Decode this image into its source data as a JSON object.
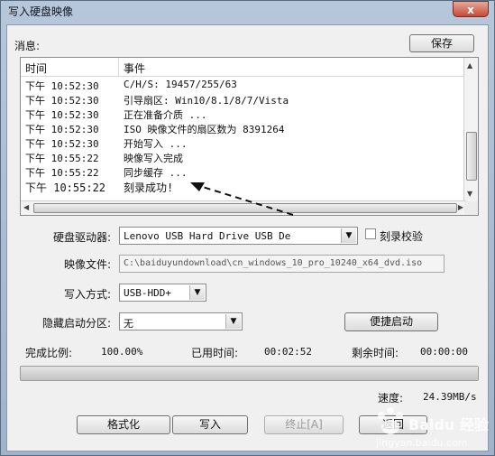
{
  "window": {
    "title": "写入硬盘映像",
    "close_label": "x"
  },
  "messages_label": "消息:",
  "save_label": "保存",
  "log": {
    "headers": [
      "时间",
      "事件"
    ],
    "rows": [
      {
        "time": "下午 10:52:30",
        "event": "C/H/S: 19457/255/63"
      },
      {
        "time": "下午 10:52:30",
        "event": "引导扇区: Win10/8.1/8/7/Vista"
      },
      {
        "time": "下午 10:52:30",
        "event": "正在准备介质 ..."
      },
      {
        "time": "下午 10:52:30",
        "event": "ISO 映像文件的扇区数为 8391264"
      },
      {
        "time": "下午 10:52:30",
        "event": "开始写入 ..."
      },
      {
        "time": "下午 10:55:22",
        "event": "映像写入完成"
      },
      {
        "time": "下午 10:55:22",
        "event": "同步缓存 ..."
      },
      {
        "time": "下午 10:55:22",
        "event": "刻录成功!"
      }
    ]
  },
  "drive": {
    "label": "硬盘驱动器:",
    "value": "Lenovo USB Hard Drive USB De",
    "verify_label": "刻录校验"
  },
  "image_file": {
    "label": "映像文件:",
    "value": "C:\\baiduyundownload\\cn_windows_10_pro_10240_x64_dvd.iso"
  },
  "write_mode": {
    "label": "写入方式:",
    "value": "USB-HDD+"
  },
  "hidden_partition": {
    "label": "隐藏启动分区:",
    "value": "无"
  },
  "quick_boot_label": "便捷启动",
  "stats": {
    "completion_label": "完成比例:",
    "completion_value": "100.00%",
    "elapsed_label": "已用时间:",
    "elapsed_value": "00:02:52",
    "remaining_label": "剩余时间:",
    "remaining_value": "00:00:00",
    "speed_label": "速度:",
    "speed_value": "24.39MB/s"
  },
  "progress": {
    "fraction": 1.0
  },
  "buttons": {
    "format": "格式化",
    "write": "写入",
    "abort": "终止[A]",
    "back": "返回"
  },
  "watermark": {
    "site": "jingyan.baidu.com",
    "brand": "Baidu 经验"
  }
}
